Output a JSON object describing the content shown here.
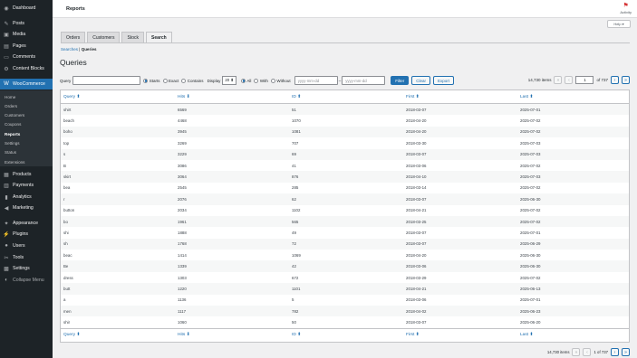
{
  "sidebar": {
    "items_top": [
      {
        "icon": "dashboard-icon",
        "glyph": "◉",
        "label": "Dashboard"
      },
      {
        "icon": "posts-icon",
        "glyph": "✎",
        "label": "Posts"
      },
      {
        "icon": "media-icon",
        "glyph": "▣",
        "label": "Media"
      },
      {
        "icon": "pages-icon",
        "glyph": "▤",
        "label": "Pages"
      },
      {
        "icon": "comments-icon",
        "glyph": "▭",
        "label": "Comments"
      },
      {
        "icon": "content-blocks-icon",
        "glyph": "⚙",
        "label": "Content Blocks"
      }
    ],
    "woocommerce": {
      "icon": "woocommerce-icon",
      "glyph": "W",
      "label": "WooCommerce"
    },
    "sub": [
      "Home",
      "Orders",
      "Customers",
      "Coupons",
      "Reports",
      "Settings",
      "Status",
      "Extensions"
    ],
    "items_bottom": [
      {
        "icon": "products-icon",
        "glyph": "▦",
        "label": "Products"
      },
      {
        "icon": "payments-icon",
        "glyph": "▥",
        "label": "Payments"
      },
      {
        "icon": "analytics-icon",
        "glyph": "▮",
        "label": "Analytics"
      },
      {
        "icon": "marketing-icon",
        "glyph": "◀",
        "label": "Marketing"
      },
      {
        "icon": "appearance-icon",
        "glyph": "✦",
        "label": "Appearance"
      },
      {
        "icon": "plugins-icon",
        "glyph": "⚡",
        "label": "Plugins"
      },
      {
        "icon": "users-icon",
        "glyph": "●",
        "label": "Users"
      },
      {
        "icon": "tools-icon",
        "glyph": "✂",
        "label": "Tools"
      },
      {
        "icon": "settings-icon",
        "glyph": "▩",
        "label": "Settings"
      },
      {
        "icon": "collapse-icon",
        "glyph": "◐",
        "label": "Collapse Menu"
      }
    ]
  },
  "topbar": {
    "title": "Reports",
    "activity": "Activity",
    "help": "Help ▾"
  },
  "tabs": [
    "Orders",
    "Customers",
    "Stock",
    "Search"
  ],
  "breadcrumb": {
    "link": "Searches",
    "sep": " | ",
    "current": "Queries"
  },
  "heading": "Queries",
  "filter": {
    "query_label": "Query",
    "match_options": [
      "Starts",
      "Exact",
      "Contains"
    ],
    "display_label": "Display",
    "display_value": "20 ⬍",
    "with_options": [
      "All",
      "With",
      "Without"
    ],
    "date_from_placeholder": "yyyy-mm-dd",
    "date_to_placeholder": "yyyy-mm-dd",
    "dash": "–",
    "filter_btn": "Filter",
    "clear_btn": "Clear",
    "export_btn": "Export"
  },
  "pagination": {
    "items": "14,730 items",
    "first": "«",
    "prev": "‹",
    "page": "1",
    "of": "of 737",
    "next": "›",
    "last": "»",
    "bottom_page": "1 of 737"
  },
  "table": {
    "columns": [
      "Query ⬍",
      "Hits ⬇",
      "ID ⬍",
      "First ⬍",
      "Last ⬍"
    ],
    "rows": [
      [
        "shirt",
        "6569",
        "51",
        "2018-03-07",
        "2025-07-01"
      ],
      [
        "beach",
        "4468",
        "1070",
        "2018-04-20",
        "2025-07-02"
      ],
      [
        "boho",
        "3945",
        "1081",
        "2018-04-20",
        "2025-07-02"
      ],
      [
        "top",
        "3269",
        "707",
        "2018-03-30",
        "2025-07-03"
      ],
      [
        "s",
        "3229",
        "69",
        "2018-03-07",
        "2025-07-03"
      ],
      [
        "B",
        "3086",
        "41",
        "2018-03-06",
        "2025-07-02"
      ],
      [
        "skirt",
        "3064",
        "876",
        "2018-04-10",
        "2025-07-03"
      ],
      [
        "bea",
        "2545",
        "285",
        "2018-03-14",
        "2025-07-02"
      ],
      [
        "r",
        "2076",
        "62",
        "2018-03-07",
        "2025-06-30"
      ],
      [
        "button",
        "2034",
        "1102",
        "2018-04-21",
        "2025-07-02"
      ],
      [
        "bo",
        "1961",
        "565",
        "2018-03-25",
        "2025-07-02"
      ],
      [
        "shi",
        "1888",
        "49",
        "2018-03-07",
        "2025-07-01"
      ],
      [
        "sh",
        "1768",
        "72",
        "2018-03-07",
        "2025-06-29"
      ],
      [
        "beac",
        "1414",
        "1069",
        "2018-04-20",
        "2025-06-30"
      ],
      [
        "Be",
        "1339",
        "42",
        "2018-03-06",
        "2025-06-30"
      ],
      [
        "dress",
        "1303",
        "672",
        "2018-03-29",
        "2025-07-02"
      ],
      [
        "butt",
        "1220",
        "1101",
        "2018-04-21",
        "2025-06-13"
      ],
      [
        "a",
        "1136",
        "5",
        "2018-03-06",
        "2025-07-01"
      ],
      [
        "men",
        "1117",
        "782",
        "2018-04-02",
        "2025-06-23"
      ],
      [
        "shir",
        "1060",
        "50",
        "2018-03-07",
        "2025-06-20"
      ]
    ]
  }
}
